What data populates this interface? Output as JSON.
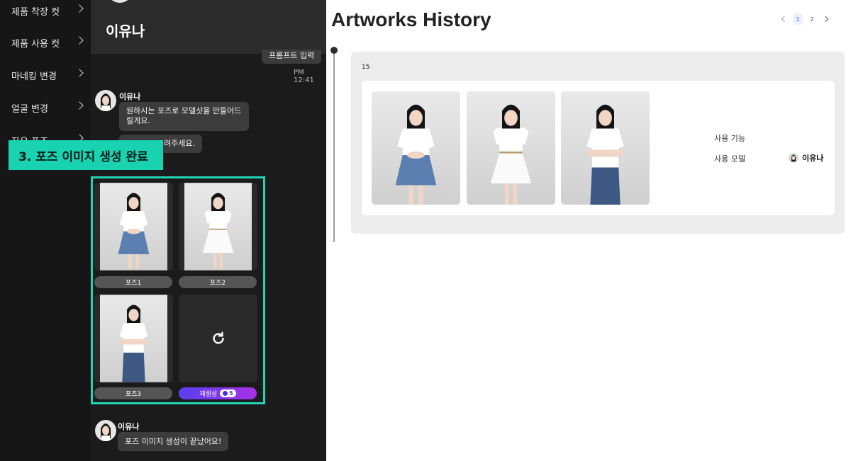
{
  "sidebar": {
    "items": [
      {
        "label": "제품 착장 컷"
      },
      {
        "label": "제품 사용 컷"
      },
      {
        "label": "마네킹 변경"
      },
      {
        "label": "얼굴 변경"
      },
      {
        "label": "자유 포즈"
      }
    ]
  },
  "chat": {
    "header_name": "이유나",
    "user_prompt": "프롬프트 입력",
    "user_time": "PM 12:41",
    "bot_name": "이유나",
    "bot_message_1": "원하시는 포즈로 모델샷을 만들어드릴게요.",
    "bot_message_2": "려주세요.",
    "callout": "3. 포즈 이미지 생성 완료",
    "results": [
      {
        "label": "포즈1"
      },
      {
        "label": "포즈2"
      },
      {
        "label": "포즈3"
      }
    ],
    "regen_label": "재생성",
    "regen_credits": "5",
    "final_name": "이유나",
    "final_message": "포즈 이미지 생성이 끝났어요!"
  },
  "history": {
    "title": "Artworks History",
    "pages": [
      "1",
      "2"
    ],
    "active_page": "1",
    "count": "15",
    "feature_label": "사용 기능",
    "feature_value": "",
    "model_label": "사용 모델",
    "model_value": "이유나"
  },
  "colors": {
    "accent": "#1fd6b3",
    "regen_gradient_start": "#5a3ff0",
    "regen_gradient_end": "#a631e6"
  },
  "icons": [
    "chevron-right-icon",
    "refresh-icon",
    "credit-icon",
    "chevron-left-icon"
  ]
}
